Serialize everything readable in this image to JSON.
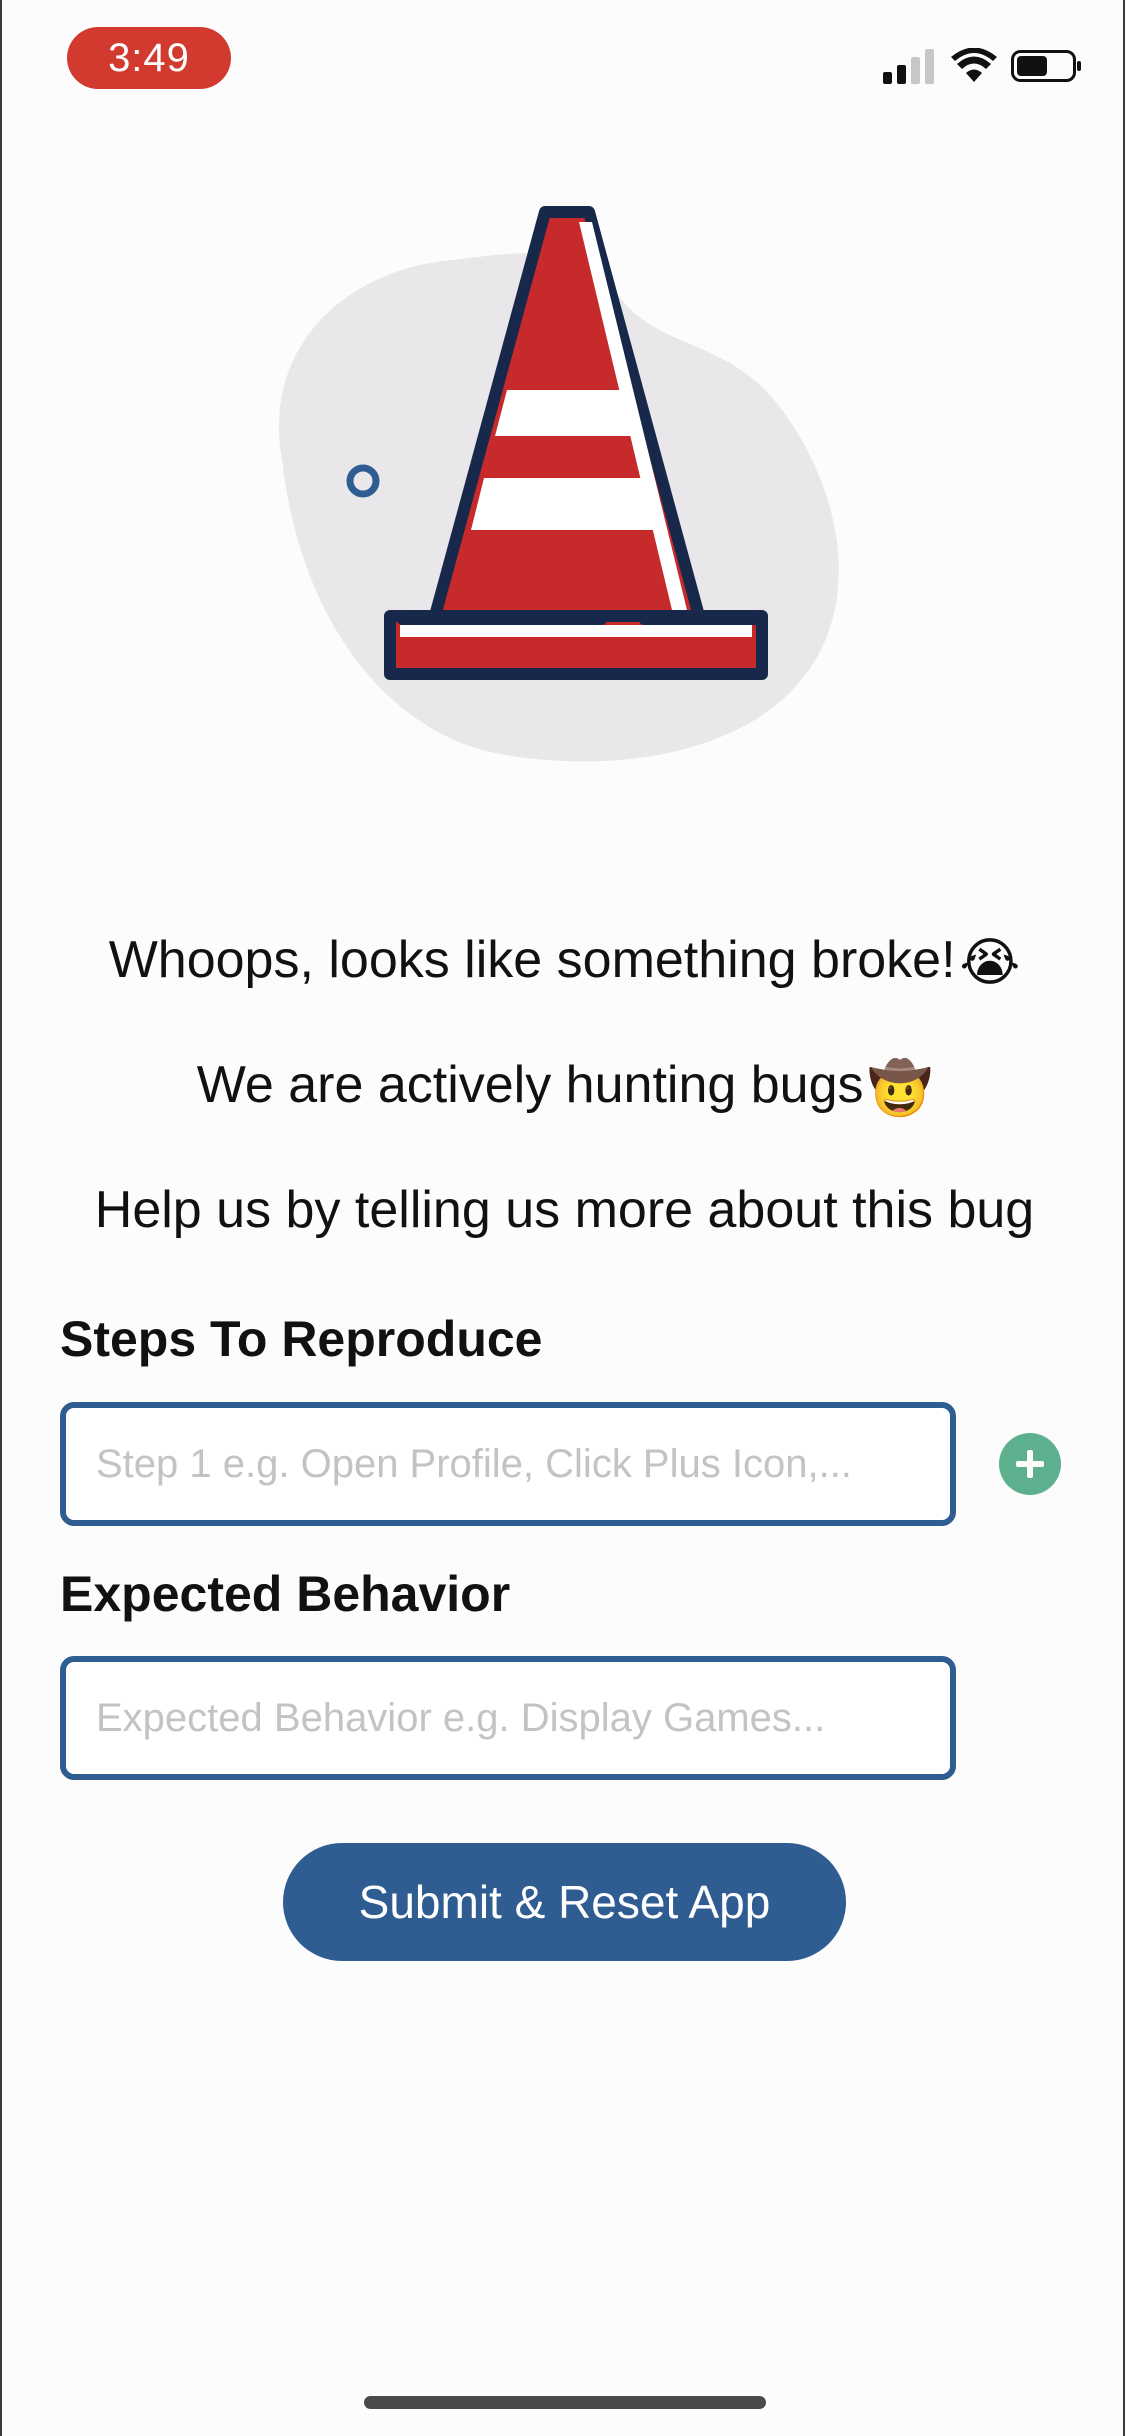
{
  "status_bar": {
    "time": "3:49",
    "icons": [
      "cellular-signal-icon",
      "wifi-icon",
      "battery-icon"
    ]
  },
  "illustration": {
    "subject": "traffic-cone-icon",
    "colors": {
      "cone_red": "#c72a2a",
      "outline": "#17284a",
      "blob": "#e9e7ea",
      "dot": "#2f5d92"
    }
  },
  "messages": {
    "line1": "Whoops, looks like something broke!",
    "line1_emoji": "😭",
    "line2": "We are actively hunting bugs",
    "line2_emoji": "🤠",
    "line3": "Help us by telling us more about this bug"
  },
  "form": {
    "steps_label": "Steps To Reproduce",
    "steps_placeholder": "Step 1 e.g. Open Profile, Click Plus Icon,...",
    "add_step_icon": "plus-icon",
    "expected_label": "Expected Behavior",
    "expected_placeholder": "Expected Behavior e.g. Display Games...",
    "submit_label": "Submit & Reset App"
  },
  "colors": {
    "accent": "#2f5d92",
    "add_button": "#5cb08d",
    "time_pill": "#d23a30"
  }
}
